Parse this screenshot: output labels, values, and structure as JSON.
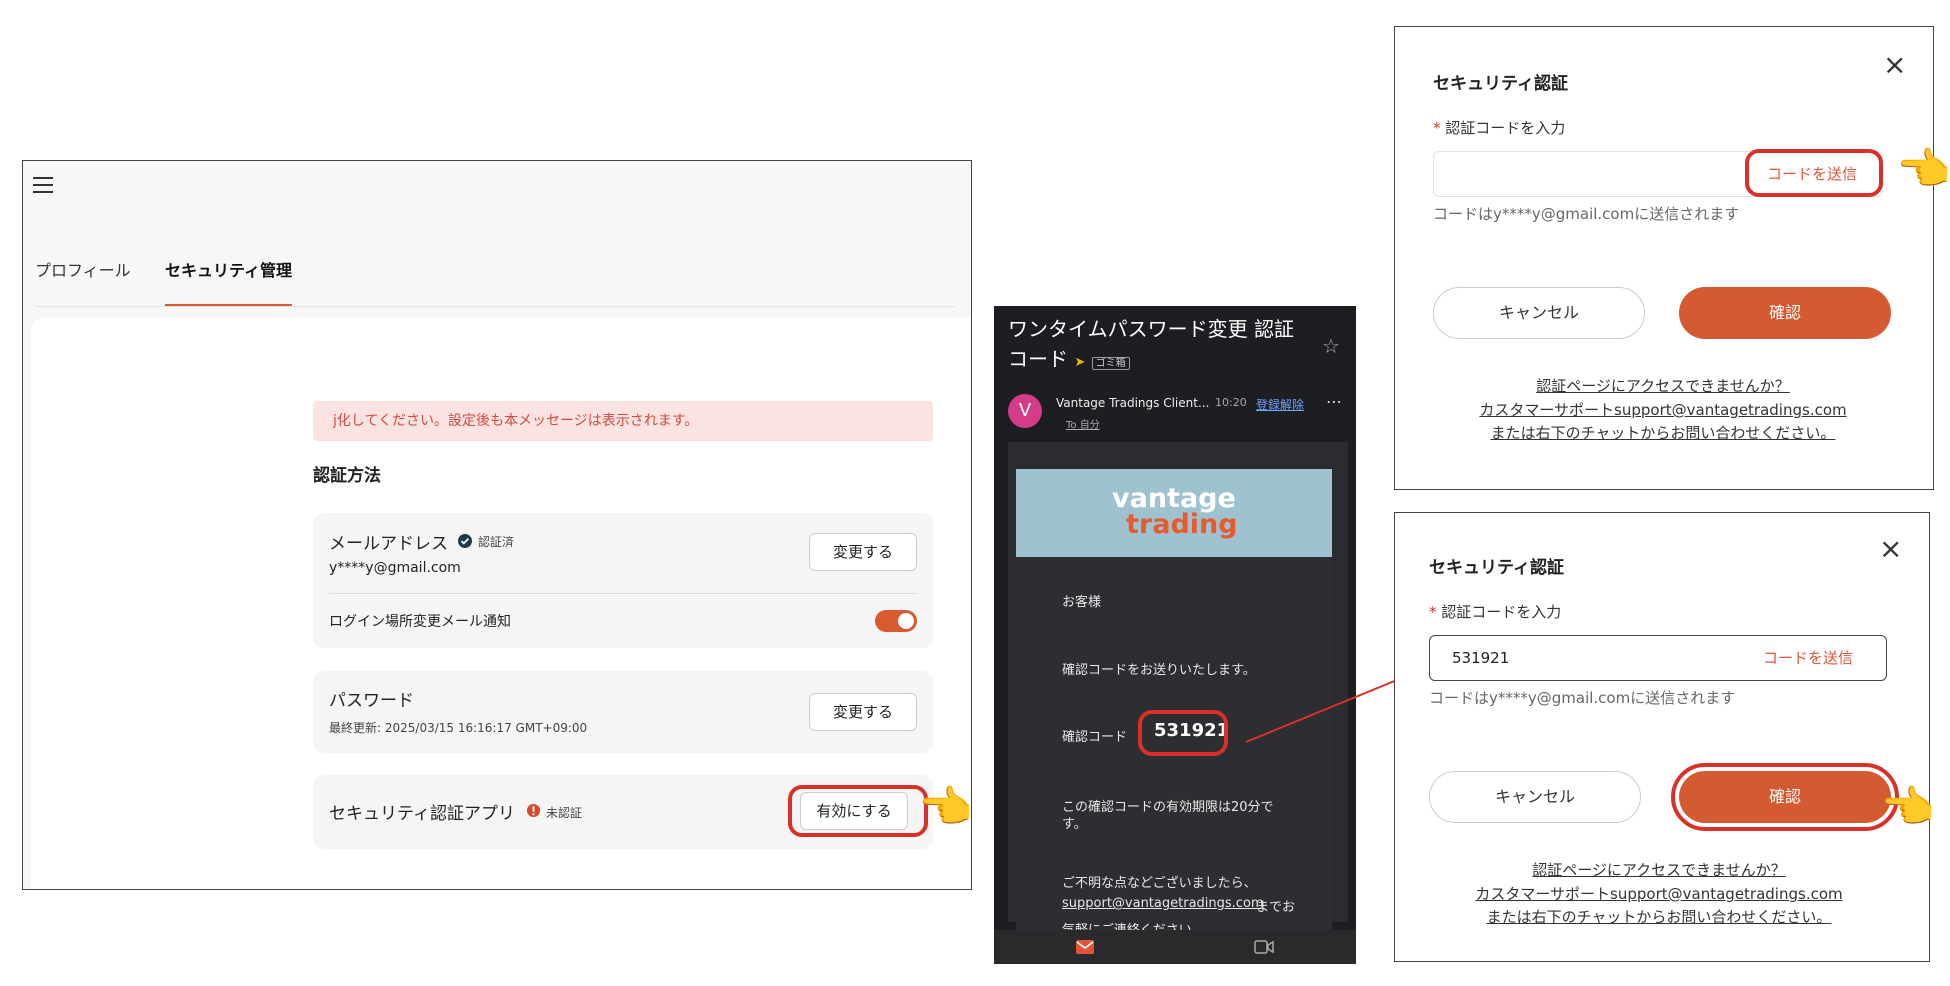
{
  "panel1": {
    "tabs": [
      "プロフィール",
      "セキュリティ管理"
    ],
    "warning": "j化してください。設定後も本メッセージは表示されます。",
    "section_title": "認証方法",
    "email": {
      "label": "メールアドレス",
      "badge": "認証済",
      "value": "y****y@gmail.com",
      "button": "変更する",
      "notify_label": "ログイン場所変更メール通知"
    },
    "password": {
      "label": "パスワード",
      "updated": "最終更新: 2025/03/15 16:16:17 GMT+09:00",
      "button": "変更する"
    },
    "app": {
      "label": "セキュリティ認証アプリ",
      "badge": "未認証",
      "button": "有効にする"
    }
  },
  "email_view": {
    "subject": "ワンタイムパスワード変更 認証コード",
    "folder": "ゴミ箱",
    "avatar": "V",
    "sender": "Vantage Tradings Client...",
    "time": "10:20",
    "unsubscribe": "登録解除",
    "to": "To 自分",
    "brand_line1": "vantage",
    "brand_line2": "trading",
    "greeting": "お客様",
    "line1": "確認コードをお送りいたします。",
    "code_label": "確認コード",
    "code": "531921",
    "validity": "この確認コードの有効期限は20分です。",
    "contact1": "ご不明な点などございましたら、",
    "contact_email": "support@vantagetradings.com",
    "contact2": "までお",
    "contact3": "気軽にご連絡ください。"
  },
  "dialog1": {
    "title": "セキュリティ認証",
    "field_label": "認証コードを入力",
    "input_value": "",
    "send": "コードを送信",
    "hint": "コードはy****y@gmail.comに送信されます",
    "cancel": "キャンセル",
    "confirm": "確認",
    "link1": "認証ページにアクセスできませんか？",
    "link2": "カスタマーサポートsupport@vantagetradings.com",
    "link3": "または右下のチャットからお問い合わせください。"
  },
  "dialog2": {
    "title": "セキュリティ認証",
    "field_label": "認証コードを入力",
    "input_value": "531921",
    "send": "コードを送信",
    "hint": "コードはy****y@gmail.comに送信されます",
    "cancel": "キャンセル",
    "confirm": "確認",
    "link1": "認証ページにアクセスできませんか？",
    "link2": "カスタマーサポートsupport@vantagetradings.com",
    "link3": "または右下のチャットからお問い合わせください。"
  },
  "colors": {
    "accent": "#d45a32",
    "highlight": "#d9302a"
  },
  "icons": [
    "hamburger-icon",
    "verified-icon",
    "warning-icon",
    "star-icon",
    "more-icon",
    "mail-icon",
    "video-icon",
    "close-icon",
    "pointing-hand-icon"
  ]
}
